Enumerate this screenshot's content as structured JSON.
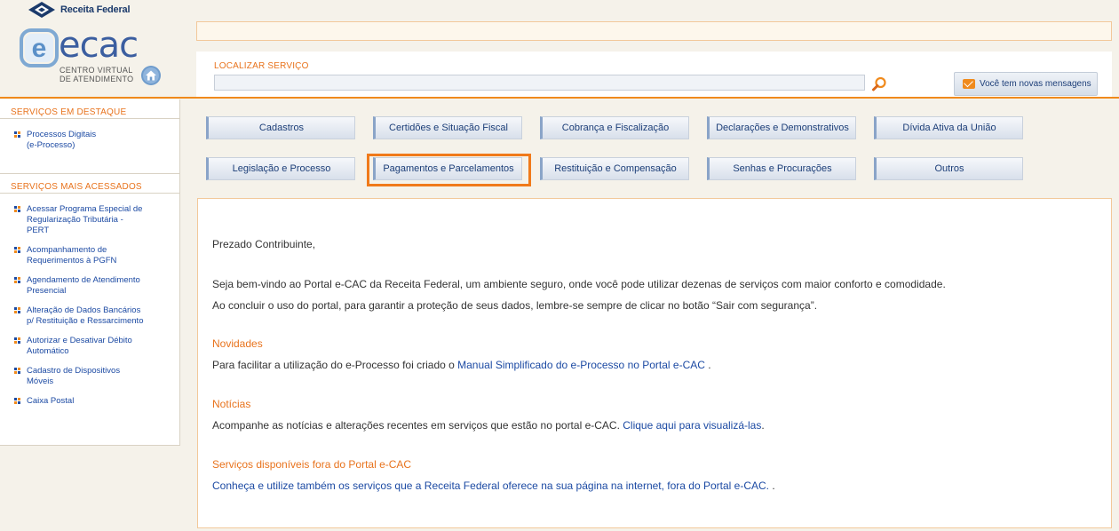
{
  "header": {
    "rf_logo_text": "Receita Federal",
    "ecac_brand": "ecac",
    "ecac_subtitle_1": "CENTRO VIRTUAL",
    "ecac_subtitle_2": "DE ATENDIMENTO"
  },
  "search": {
    "label": "LOCALIZAR SERVIÇO",
    "value": "",
    "placeholder": ""
  },
  "messages_button": "Você tem novas mensagens",
  "sidebar": {
    "featured_title": "SERVIÇOS EM DESTAQUE",
    "featured_items": [
      {
        "line1": "Processos Digitais",
        "line2": "(e-Processo)",
        "line3": ""
      }
    ],
    "popular_title": "SERVIÇOS MAIS ACESSADOS",
    "popular_items": [
      {
        "line1": "Acessar Programa Especial de",
        "line2": "Regularização Tributária -",
        "line3": "PERT"
      },
      {
        "line1": "Acompanhamento de",
        "line2": "Requerimentos à PGFN",
        "line3": ""
      },
      {
        "line1": "Agendamento de Atendimento",
        "line2": "Presencial",
        "line3": ""
      },
      {
        "line1": "Alteração de Dados Bancários",
        "line2": "p/ Restituição e Ressarcimento",
        "line3": ""
      },
      {
        "line1": "Autorizar e Desativar Débito",
        "line2": "Automático",
        "line3": ""
      },
      {
        "line1": "Cadastro de Dispositivos",
        "line2": "Móveis",
        "line3": ""
      },
      {
        "line1": "Caixa Postal",
        "line2": "",
        "line3": ""
      }
    ]
  },
  "categories": [
    "Cadastros",
    "Certidões e Situação Fiscal",
    "Cobrança e Fiscalização",
    "Declarações e Demonstrativos",
    "Dívida Ativa da União",
    "Legislação e Processo",
    "Pagamentos e Parcelamentos",
    "Restituição e Compensação",
    "Senhas e Procurações",
    "Outros"
  ],
  "content": {
    "greeting": "Prezado Contribuinte,",
    "welcome": "Seja bem-vindo ao Portal e-CAC da Receita Federal, um ambiente seguro, onde você pode utilizar dezenas de serviços com maior conforto e comodidade.",
    "security_note": "Ao concluir o uso do portal, para garantir a proteção de seus dados, lembre-se sempre de clicar no botão “Sair com segurança”.",
    "novidades_title": "Novidades",
    "novidades_text": "Para facilitar a utilização do e-Processo foi criado o ",
    "novidades_link": "Manual Simplificado do e-Processo no Portal e-CAC",
    "novidades_end": " .",
    "noticias_title": "Notícias",
    "noticias_text": "Acompanhe as notícias e alterações recentes em serviços que estão no portal e-CAC. ",
    "noticias_link": "Clique aqui para visualizá-las",
    "noticias_end": ".",
    "fora_title": "Serviços disponíveis fora do Portal e-CAC",
    "fora_link": "Conheça e utilize também os serviços que a Receita Federal oferece na sua página na internet, fora do Portal e-CAC.",
    "fora_end": " ."
  },
  "colors": {
    "accent_orange": "#f08a1c",
    "link_blue": "#1c4aa3",
    "highlight": "#f07a1a"
  }
}
